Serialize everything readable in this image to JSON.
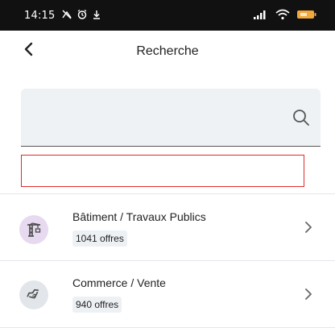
{
  "status_bar": {
    "time": "14:15",
    "icons": [
      "slash-icon",
      "alarm-icon",
      "download-icon",
      "signal-icon",
      "wifi-icon",
      "battery-icon"
    ],
    "battery_color": "#f2a93b"
  },
  "header": {
    "title": "Recherche",
    "back_icon": "chevron-left-icon"
  },
  "search": {
    "value": "",
    "placeholder": "",
    "icon": "search-icon"
  },
  "categories": [
    {
      "label": "Bâtiment / Travaux Publics",
      "count": "1041 offres",
      "icon": "crane-icon",
      "icon_bg": "#e6d9f0"
    },
    {
      "label": "Commerce / Vente",
      "count": "940 offres",
      "icon": "handshake-icon",
      "icon_bg": "#e2e6ea"
    }
  ],
  "colors": {
    "highlight_border": "#e02b2b",
    "search_bg": "#eef2f5"
  }
}
